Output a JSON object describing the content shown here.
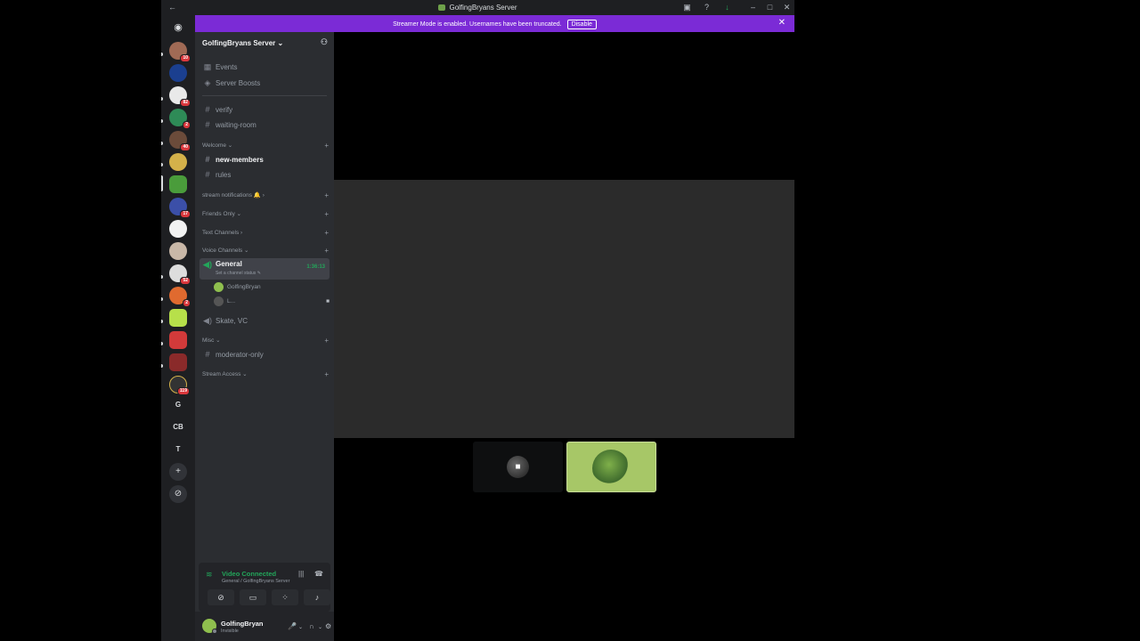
{
  "window": {
    "title": "GolfingBryans Server"
  },
  "banner": {
    "message": "Streamer Mode is enabled. Usernames have been truncated.",
    "disable_label": "Disable"
  },
  "rail": {
    "guilds": [
      {
        "badge": "",
        "color": "#5865f2"
      },
      {
        "badge": "10",
        "color": "#a06a55"
      },
      {
        "badge": "",
        "color": "#1b3f8f"
      },
      {
        "badge": "82",
        "color": "#e9e9e9"
      },
      {
        "badge": "2",
        "color": "#2e8b57"
      },
      {
        "badge": "40",
        "color": "#6b4b3a"
      },
      {
        "badge": "",
        "color": "#d4b14a"
      },
      {
        "badge": "",
        "color": "#4a9c3b"
      },
      {
        "badge": "17",
        "color": "#3b4fa8"
      },
      {
        "badge": "",
        "color": "#f2f2f2"
      },
      {
        "badge": "",
        "color": "#c9b8a8"
      },
      {
        "badge": "52",
        "color": "#dddddd"
      },
      {
        "badge": "2",
        "color": "#e06a2f"
      },
      {
        "badge": "",
        "color": "#b7e04a"
      },
      {
        "badge": "",
        "color": "#d23a3a"
      },
      {
        "badge": "",
        "color": "#8a2a2a"
      },
      {
        "badge": "119",
        "color": "#333333"
      }
    ],
    "text_guilds": [
      "G",
      "CB",
      "T"
    ]
  },
  "sidebar": {
    "server_name": "GolfingBryans Server",
    "top_items": [
      {
        "label": "Events"
      },
      {
        "label": "Server Boosts"
      }
    ],
    "channels_top": [
      {
        "label": "verify"
      },
      {
        "label": "waiting-room"
      }
    ],
    "categories": {
      "welcome": "Welcome",
      "stream_notifications": "stream notifications 🔔",
      "friends_only": "Friends Only",
      "text_channels": "Text Channels",
      "voice_channels": "Voice Channels",
      "misc": "Misc",
      "stream_access": "Stream Access"
    },
    "welcome_channels": [
      {
        "label": "new-members"
      },
      {
        "label": "rules"
      }
    ],
    "voice": {
      "general": "General",
      "timer": "1:36:13",
      "status": "Set a channel status",
      "users": [
        "GolfingBryan",
        "L..."
      ],
      "skate": "Skate, VC"
    },
    "misc_channels": [
      {
        "label": "moderator-only"
      }
    ]
  },
  "voice_panel": {
    "status": "Video Connected",
    "location": "General / GolfingBryans Server"
  },
  "user_panel": {
    "username": "GolfingBryan",
    "status": "Invisible"
  }
}
